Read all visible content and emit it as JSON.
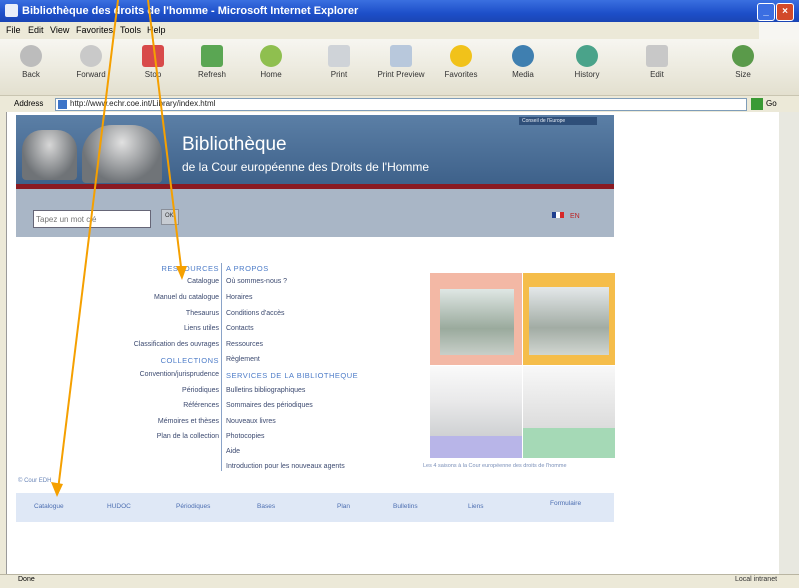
{
  "window": {
    "title": "Bibliothèque des droits de l'homme - Microsoft Internet Explorer"
  },
  "menubar": [
    "File",
    "Edit",
    "View",
    "Favorites",
    "Tools",
    "Help"
  ],
  "toolbar": {
    "buttons": [
      "Back",
      "Forward",
      "Stop",
      "Refresh",
      "Home",
      "Print",
      "Print Preview",
      "Favorites",
      "Media",
      "History",
      "Edit",
      "Size"
    ]
  },
  "address": {
    "label": "Address",
    "url": "http://www.echr.coe.int/Library/index.html",
    "go": "Go"
  },
  "banner": {
    "title": "Bibliothèque",
    "subtitle": "de la Cour européenne des Droits de l'Homme",
    "top_link": "Conseil de l'Europe",
    "search_placeholder": "Tapez un mot clé",
    "search_button": "OK",
    "lang": "EN"
  },
  "menu_left": {
    "heading1": "RESSOURCES",
    "items1": [
      "Catalogue",
      "Manuel du catalogue",
      "Thesaurus",
      "Liens utiles",
      "Classification des ouvrages"
    ],
    "heading2": "COLLECTIONS",
    "items2": [
      "Convention/jurisprudence",
      "Périodiques",
      "Références",
      "Mémoires et thèses",
      "Plan de la collection"
    ]
  },
  "menu_right": {
    "heading1": "A PROPOS",
    "items1": [
      "Où sommes-nous ?",
      "Horaires",
      "Conditions d'accès",
      "Contacts",
      "Ressources",
      "Règlement"
    ],
    "heading2": "SERVICES DE LA BIBLIOTHEQUE",
    "items2": [
      "Bulletins bibliographiques",
      "Sommaires des périodiques",
      "Nouveaux livres",
      "Photocopies",
      "Aide",
      "Introduction pour les nouveaux agents"
    ]
  },
  "photo_caption": "Les 4 saisons à la Cour européenne des droits de l'homme",
  "footer_small": "© Cour EDH",
  "tabs": [
    "Catalogue",
    "HUDOC",
    "Périodiques",
    "Bases",
    "Plan",
    "Bulletins",
    "Liens",
    "Formulaire"
  ],
  "status": {
    "left": "Done",
    "right": "Local intranet"
  },
  "colors": {
    "titlebar": "#1d4fc9",
    "banner": "#46698f",
    "arrow": "#f5a000"
  }
}
